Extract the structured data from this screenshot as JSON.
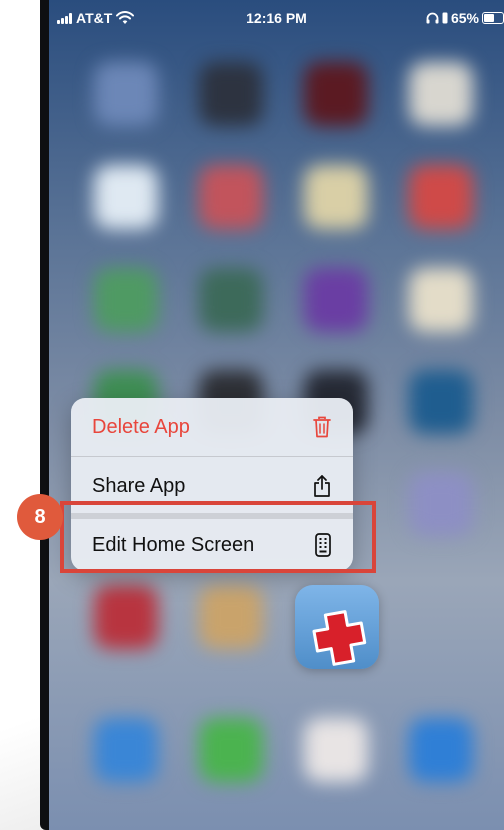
{
  "status_bar": {
    "carrier": "AT&T",
    "time": "12:16 PM",
    "battery_percent": "65%",
    "battery_level": 0.65
  },
  "context_menu": {
    "items": [
      {
        "label": "Delete App",
        "icon": "trash-icon",
        "color": "#e8463c"
      },
      {
        "label": "Share App",
        "icon": "share-icon"
      },
      {
        "label": "Edit Home Screen",
        "icon": "phone-grid-icon"
      }
    ]
  },
  "annotation": {
    "step_number": "8",
    "color": "#d9453a"
  },
  "app": {
    "icon": "red-cross-icon"
  }
}
